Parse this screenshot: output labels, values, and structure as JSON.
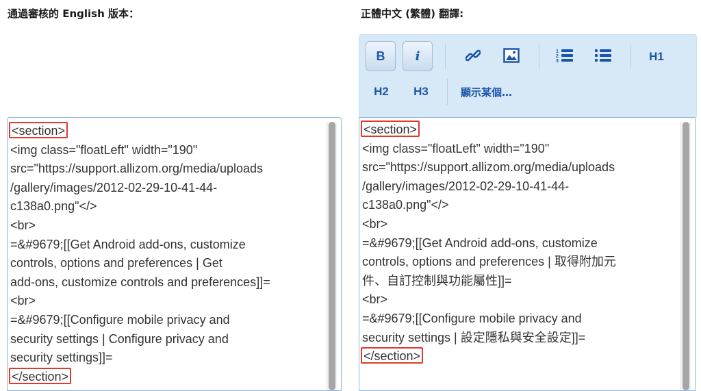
{
  "left_panel": {
    "heading": "通過審核的 English 版本：",
    "lines": [
      "<section>",
      "<img class=\"floatLeft\" width=\"190\"",
      "src=\"https://support.allizom.org/media/uploads",
      "/gallery/images/2012-02-29-10-41-44-",
      "c138a0.png\"</>",
      "<br>",
      "=&#9679;[[Get Android add-ons, customize",
      "controls, options and preferences | Get",
      "add-ons, customize controls and preferences]]=",
      "<br>",
      "=&#9679;[[Configure mobile privacy and",
      "security settings | Configure privacy and",
      "security settings]]=",
      "</section>"
    ]
  },
  "right_panel": {
    "heading": "正體中文 (繁體) 翻譯:",
    "lines": [
      "<section>",
      "<img class=\"floatLeft\" width=\"190\"",
      "src=\"https://support.allizom.org/media/uploads",
      "/gallery/images/2012-02-29-10-41-44-",
      "c138a0.png\"</>",
      "<br>",
      "=&#9679;[[Get Android add-ons, customize",
      "controls, options and preferences | 取得附加元",
      "件、自訂控制與功能屬性]]=",
      "<br>",
      "=&#9679;[[Configure mobile privacy and",
      "security settings | 設定隱私與安全設定]]=",
      "</section>"
    ]
  },
  "toolbar": {
    "bold": "B",
    "italic": "i",
    "h1": "H1",
    "h2": "H2",
    "h3": "H3",
    "show_label": "顯示某個…",
    "icons": [
      "link-icon",
      "image-icon",
      "numbered-list-icon",
      "bullet-list-icon"
    ]
  },
  "colors": {
    "highlight_box": "#e0392e",
    "toolbar_bg": "#d7e9f7",
    "toolbar_text": "#1c55a8",
    "editor_border": "#8fb3d9"
  }
}
